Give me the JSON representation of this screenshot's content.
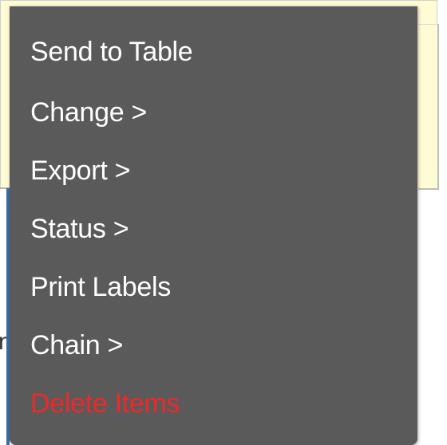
{
  "background": {
    "panel_color": "#fffbd5",
    "rail_color": "#3a6ea5",
    "partial_glyph": "n"
  },
  "context_menu": {
    "background_color": "#5a5a5a",
    "items": [
      {
        "label": "Send to Table",
        "color": "#ffffff"
      },
      {
        "label": "Change >",
        "color": "#ffffff"
      },
      {
        "label": "Export >",
        "color": "#ffffff"
      },
      {
        "label": "Status >",
        "color": "#ffffff"
      },
      {
        "label": "Print Labels",
        "color": "#ffffff"
      },
      {
        "label": "Chain >",
        "color": "#ffffff"
      },
      {
        "label": "Delete Items",
        "color": "#f02828"
      }
    ]
  }
}
